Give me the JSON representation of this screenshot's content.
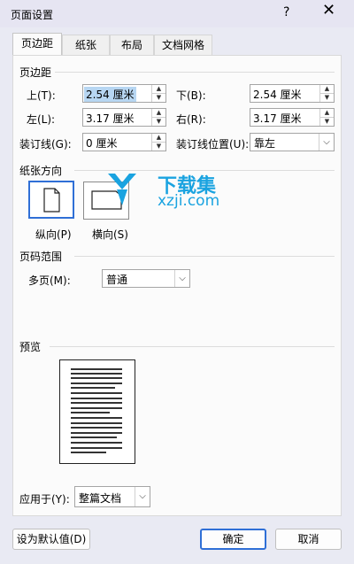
{
  "dialog": {
    "title": "页面设置",
    "help": "?",
    "close": "✕"
  },
  "tabs": [
    "页边距",
    "纸张",
    "布局",
    "文档网格"
  ],
  "margins": {
    "section": "页边距",
    "top_label": "上(T):",
    "top_value": "2.54 厘米",
    "bottom_label": "下(B):",
    "bottom_value": "2.54 厘米",
    "left_label": "左(L):",
    "left_value": "3.17 厘米",
    "right_label": "右(R):",
    "right_value": "3.17 厘米",
    "gutter_label": "装订线(G):",
    "gutter_value": "0 厘米",
    "gutter_pos_label": "装订线位置(U):",
    "gutter_pos_value": "靠左"
  },
  "orientation": {
    "section": "纸张方向",
    "portrait": "纵向(P)",
    "landscape": "横向(S)",
    "selected": "portrait"
  },
  "pages": {
    "section": "页码范围",
    "multi_label": "多页(M):",
    "multi_value": "普通"
  },
  "preview": {
    "section": "预览",
    "apply_label": "应用于(Y):",
    "apply_value": "整篇文档"
  },
  "watermark": {
    "brand": "下载集",
    "site": "xzji.com"
  },
  "buttons": {
    "default": "设为默认值(D)",
    "ok": "确定",
    "cancel": "取消"
  },
  "colors": {
    "accent": "#2f6fd6",
    "watermark": "#1aa3e0"
  }
}
